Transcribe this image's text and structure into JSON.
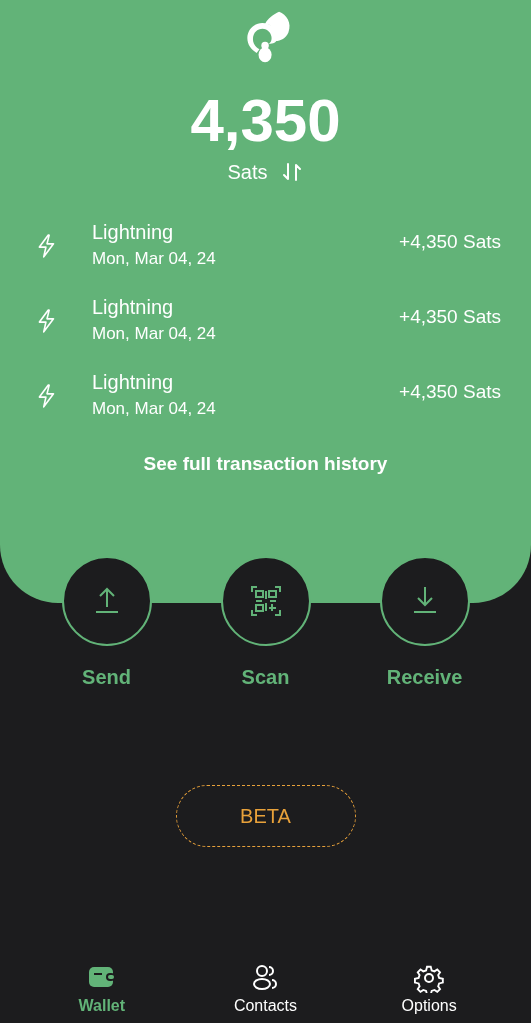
{
  "balance": {
    "amount": "4,350",
    "unit": "Sats"
  },
  "transactions": [
    {
      "kind": "lightning",
      "title": "Lightning",
      "date": "Mon, Mar 04, 24",
      "amount": "+4,350 Sats"
    },
    {
      "kind": "lightning",
      "title": "Lightning",
      "date": "Mon, Mar 04, 24",
      "amount": "+4,350 Sats"
    },
    {
      "kind": "lightning",
      "title": "Lightning",
      "date": "Mon, Mar 04, 24",
      "amount": "+4,350 Sats"
    }
  ],
  "history_link": "See full transaction history",
  "actions": [
    {
      "kind": "send",
      "label": "Send"
    },
    {
      "kind": "scan",
      "label": "Scan"
    },
    {
      "kind": "receive",
      "label": "Receive"
    }
  ],
  "beta_badge": "BETA",
  "nav": [
    {
      "kind": "wallet",
      "label": "Wallet",
      "selected": true
    },
    {
      "kind": "contacts",
      "label": "Contacts",
      "selected": false
    },
    {
      "kind": "options",
      "label": "Options",
      "selected": false
    }
  ]
}
